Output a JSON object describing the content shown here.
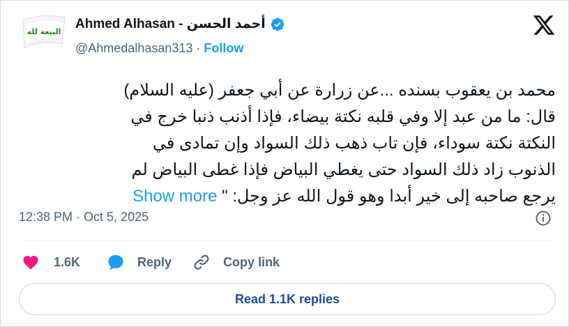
{
  "author": {
    "name": "Ahmed Alhasan - أحمد الحسن",
    "handle": "@Ahmedalhasan313",
    "separator": "·",
    "follow_label": "Follow",
    "avatar_text": "البيعة لله"
  },
  "tweet": {
    "lines": [
      "محمد بن يعقوب بسنده ...عن زرارة عن أبي جعفر (عليه السلام)",
      "قال: ما من عبد إلا وفي قلبه نكتة بيضاء، فإذا أذنب ذنبا خرج في",
      "النكتة نكتة سوداء، فإن تاب ذهب ذلك السواد وإن تمادى في",
      "الذنوب زاد ذلك السواد حتى يغطي البياض فإذا غطى البياض لم",
      "يرجع صاحبه إلى خير أبدا وهو قول الله عز وجل: \""
    ],
    "show_more": "Show more",
    "timestamp": "12:38 PM · Oct 5, 2025"
  },
  "actions": {
    "like_count": "1.6K",
    "reply_label": "Reply",
    "copy_link_label": "Copy link"
  },
  "read_replies_label": "Read 1.1K replies",
  "colors": {
    "accent": "#1d9bf0",
    "heart": "#f91880",
    "muted": "#536471",
    "verified": "#1d9bf0"
  }
}
